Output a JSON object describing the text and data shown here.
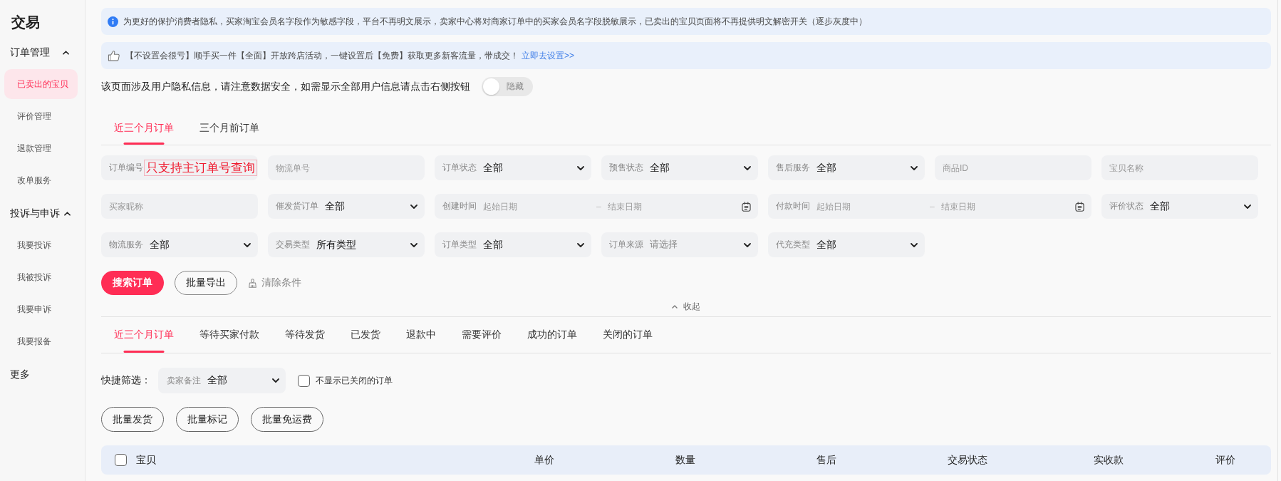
{
  "sidebar": {
    "title": "交易",
    "groups": [
      {
        "kind": "group",
        "label": "订单管理",
        "expanded": true,
        "items": [
          {
            "label": "已卖出的宝贝",
            "selected": true
          },
          {
            "label": "评价管理",
            "selected": false
          },
          {
            "label": "退款管理",
            "selected": false
          },
          {
            "label": "改单服务",
            "selected": false
          }
        ]
      },
      {
        "kind": "group",
        "label": "投诉与申诉",
        "expanded": true,
        "items": [
          {
            "label": "我要投诉",
            "selected": false
          },
          {
            "label": "我被投诉",
            "selected": false
          },
          {
            "label": "我要申诉",
            "selected": false
          },
          {
            "label": "我要报备",
            "selected": false
          }
        ]
      },
      {
        "kind": "link",
        "label": "更多"
      }
    ]
  },
  "notices": [
    {
      "kind": "info",
      "text": "为更好的保护消费者隐私，买家淘宝会员名字段作为敏感字段，平台不再明文展示，卖家中心将对商家订单中的买家会员名字段脱敏展示，已卖出的宝贝页面将不再提供明文解密开关（逐步灰度中）"
    },
    {
      "kind": "promo",
      "text": "【不设置会很亏】顺手买一件【全面】开放跨店活动，一键设置后【免费】获取更多新客流量，带成交！",
      "link": "立即去设置>>"
    }
  ],
  "privacy": {
    "text": "该页面涉及用户隐私信息，请注意数据安全，如需显示全部用户信息请点击右侧按钮",
    "toggle": {
      "label": "隐藏",
      "on": false
    }
  },
  "range_tabs": [
    {
      "label": "近三个月订单",
      "selected": true
    },
    {
      "label": "三个月前订单",
      "selected": false
    }
  ],
  "filters": [
    {
      "kind": "input",
      "label": "订单编号",
      "annotation": "只支持主订单号查询"
    },
    {
      "kind": "input",
      "placeholder": "物流单号"
    },
    {
      "kind": "select",
      "label": "订单状态",
      "value": "全部"
    },
    {
      "kind": "select",
      "label": "预售状态",
      "value": "全部"
    },
    {
      "kind": "select",
      "label": "售后服务",
      "value": "全部"
    },
    {
      "kind": "input",
      "placeholder": "商品ID"
    },
    {
      "kind": "input",
      "placeholder": "宝贝名称"
    },
    {
      "kind": "input",
      "placeholder": "买家昵称"
    },
    {
      "kind": "select",
      "label": "催发货订单",
      "value": "全部"
    },
    {
      "kind": "daterange",
      "label": "创建时间",
      "start_placeholder": "起始日期",
      "separator": "–",
      "end_placeholder": "结束日期"
    },
    {
      "kind": "daterange",
      "label": "付款时间",
      "start_placeholder": "起始日期",
      "separator": "–",
      "end_placeholder": "结束日期"
    },
    {
      "kind": "select",
      "label": "评价状态",
      "value": "全部"
    },
    {
      "kind": "select",
      "label": "物流服务",
      "value": "全部"
    },
    {
      "kind": "select",
      "label": "交易类型",
      "value": "所有类型"
    },
    {
      "kind": "select",
      "label": "订单类型",
      "value": "全部"
    },
    {
      "kind": "select",
      "label": "订单来源",
      "placeholder": "请选择"
    },
    {
      "kind": "select",
      "label": "代充类型",
      "value": "全部"
    }
  ],
  "actions": [
    {
      "kind": "primary",
      "label": "搜索订单"
    },
    {
      "kind": "outline",
      "label": "批量导出"
    },
    {
      "kind": "text",
      "label": "清除条件"
    }
  ],
  "collapse": {
    "label": "收起"
  },
  "status_tabs": [
    {
      "label": "近三个月订单",
      "selected": true
    },
    {
      "label": "等待买家付款",
      "selected": false
    },
    {
      "label": "等待发货",
      "selected": false
    },
    {
      "label": "已发货",
      "selected": false
    },
    {
      "label": "退款中",
      "selected": false
    },
    {
      "label": "需要评价",
      "selected": false
    },
    {
      "label": "成功的订单",
      "selected": false
    },
    {
      "label": "关闭的订单",
      "selected": false
    }
  ],
  "quick_filter": {
    "label": "快捷筛选：",
    "select": {
      "label": "卖家备注",
      "value": "全部"
    },
    "checkbox": {
      "label": "不显示已关闭的订单",
      "checked": false
    }
  },
  "batch_buttons": [
    "批量发货",
    "批量标记",
    "批量免运费"
  ],
  "table": {
    "select_all": {
      "checked": false
    },
    "columns": [
      "宝贝",
      "单价",
      "数量",
      "售后",
      "交易状态",
      "实收款",
      "评价"
    ]
  }
}
